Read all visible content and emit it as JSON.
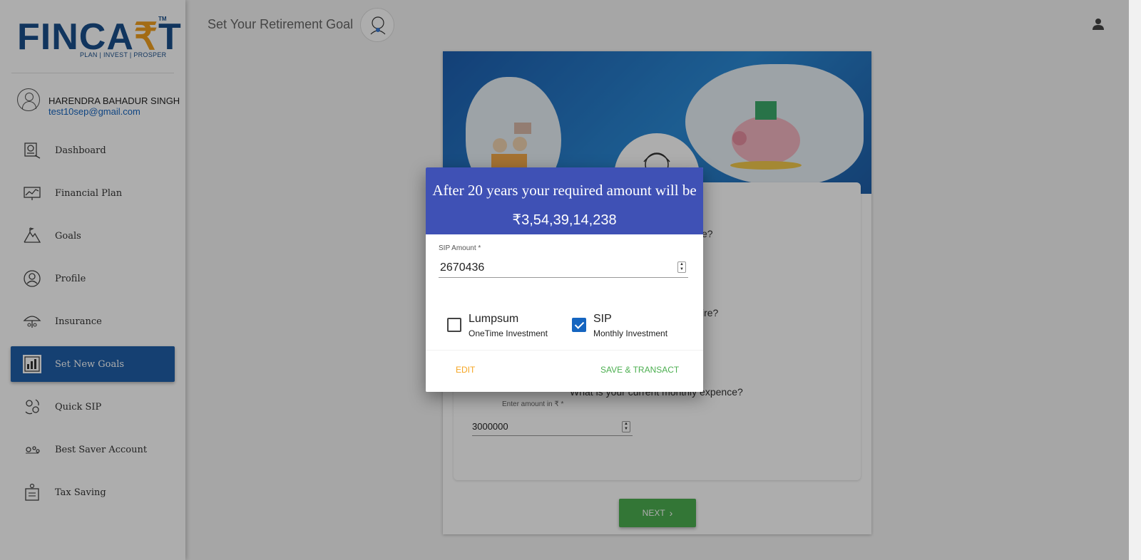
{
  "brand": {
    "logo_text_a": "FINCA",
    "logo_text_r": "₹",
    "logo_text_b": "T",
    "tm": "TM",
    "tagline": "PLAN | INVEST | PROSPER"
  },
  "user": {
    "name": "HARENDRA BAHADUR SINGH",
    "email": "test10sep@gmail.com"
  },
  "sidebar": {
    "items": [
      {
        "label": "Dashboard",
        "icon": "dashboard-icon"
      },
      {
        "label": "Financial Plan",
        "icon": "financial-plan-icon"
      },
      {
        "label": "Goals",
        "icon": "goals-icon"
      },
      {
        "label": "Profile",
        "icon": "profile-icon"
      },
      {
        "label": "Insurance",
        "icon": "insurance-icon"
      },
      {
        "label": "Set New Goals",
        "icon": "set-new-goals-icon",
        "active": true
      },
      {
        "label": "Quick SIP",
        "icon": "quick-sip-icon"
      },
      {
        "label": "Best Saver Account",
        "icon": "best-saver-icon"
      },
      {
        "label": "Tax Saving",
        "icon": "tax-saving-icon"
      }
    ]
  },
  "header": {
    "title": "Set Your Retirement Goal"
  },
  "form": {
    "q1_suffix": "e?",
    "q2_suffix": "ire?",
    "q3": "What is your current monthly expence?",
    "amount_label": "Enter amount in ₹ *",
    "amount_value": "3000000",
    "next_label": "NEXT",
    "next_icon": "›"
  },
  "dialog": {
    "title": "After 20 years your required amount will be",
    "amount": "₹3,54,39,14,238",
    "sip_label": "SIP Amount *",
    "sip_value": "2670436",
    "options": [
      {
        "title": "Lumpsum",
        "subtitle": "OneTime Investment",
        "checked": false
      },
      {
        "title": "SIP",
        "subtitle": "Monthly Investment",
        "checked": true
      }
    ],
    "edit_label": "EDIT",
    "save_label": "SAVE & TRANSACT"
  },
  "colors": {
    "primary": "#3f51b5",
    "active_nav": "#1f5fa8",
    "success": "#4caf50",
    "warning": "#f5a623",
    "link": "#1565c0"
  }
}
